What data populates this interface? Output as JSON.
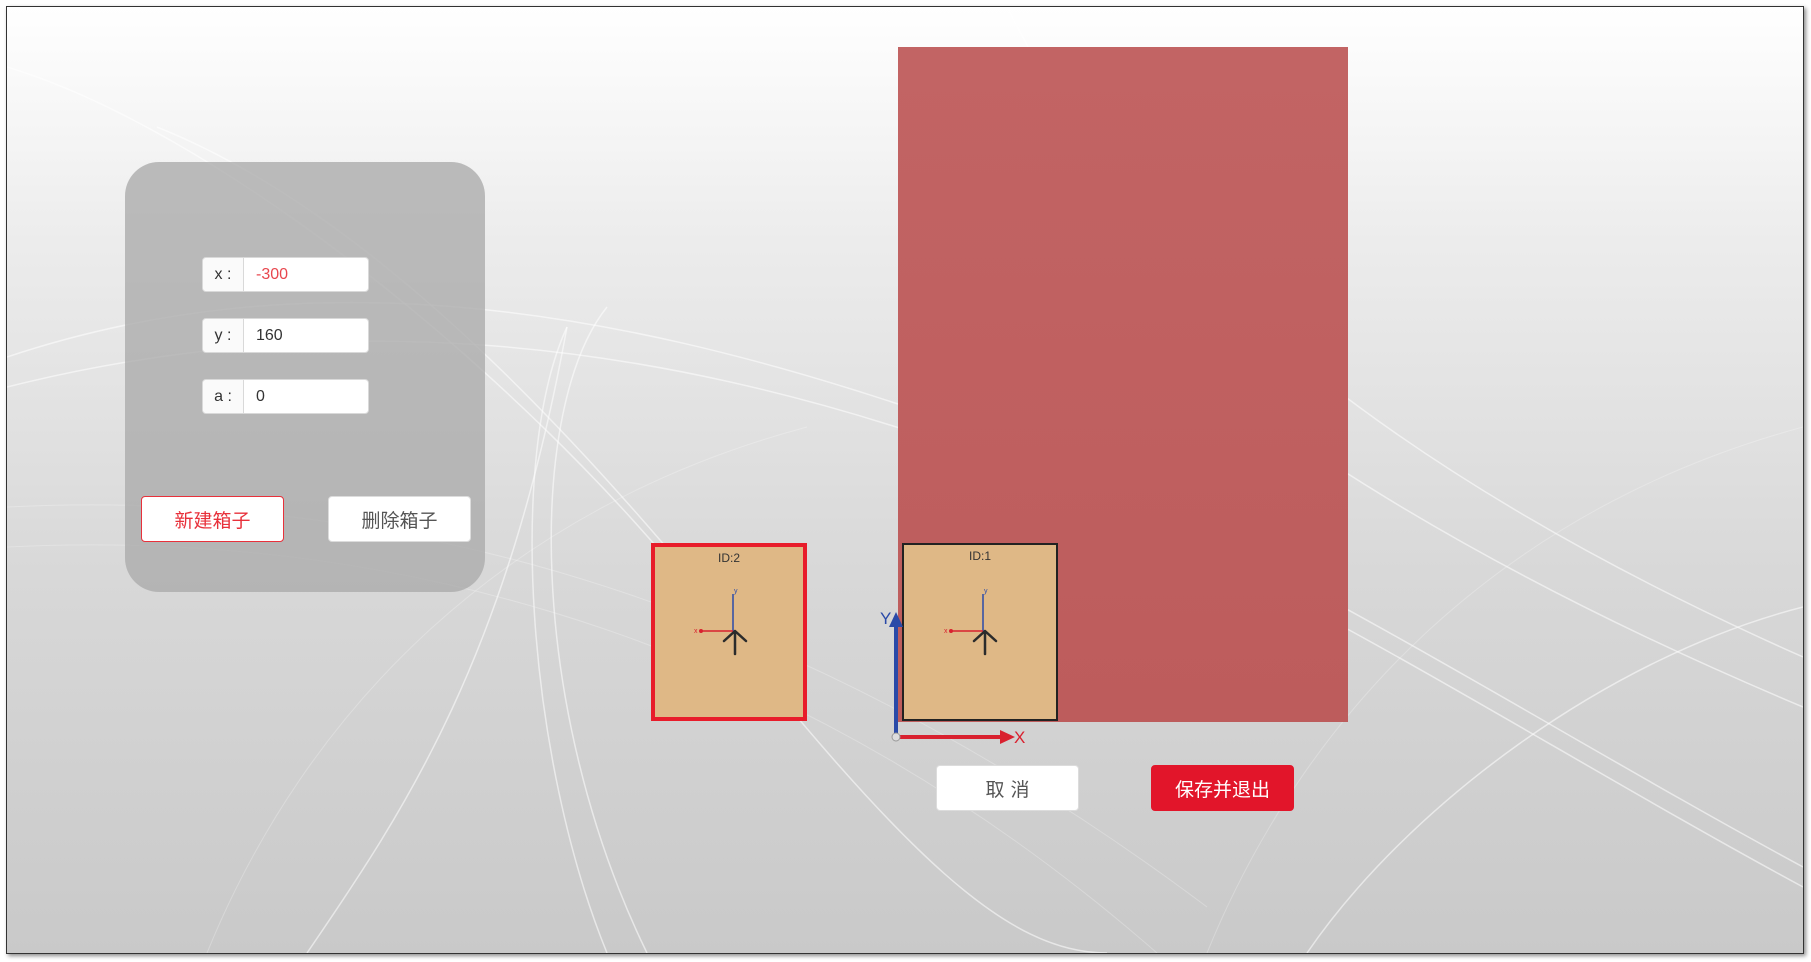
{
  "panel": {
    "fields": [
      {
        "label": "x :",
        "value": "-300"
      },
      {
        "label": "y :",
        "value": "160"
      },
      {
        "label": "a :",
        "value": "0"
      }
    ],
    "new_box_label": "新建箱子",
    "delete_box_label": "删除箱子"
  },
  "boxes": [
    {
      "id_label": "ID:2",
      "selected": true
    },
    {
      "id_label": "ID:1",
      "selected": false
    }
  ],
  "box_axis_labels": {
    "x": "x",
    "y": "y"
  },
  "origin_axes": {
    "x_label": "X",
    "y_label": "Y"
  },
  "footer": {
    "cancel_label": "取 消",
    "save_exit_label": "保存并退出"
  },
  "colors": {
    "container": "#c05f5f",
    "box_fill": "#dfb886",
    "selected_border": "#e81c2a",
    "accent_red": "#e2152a",
    "axis_blue": "#2a4aa8"
  }
}
